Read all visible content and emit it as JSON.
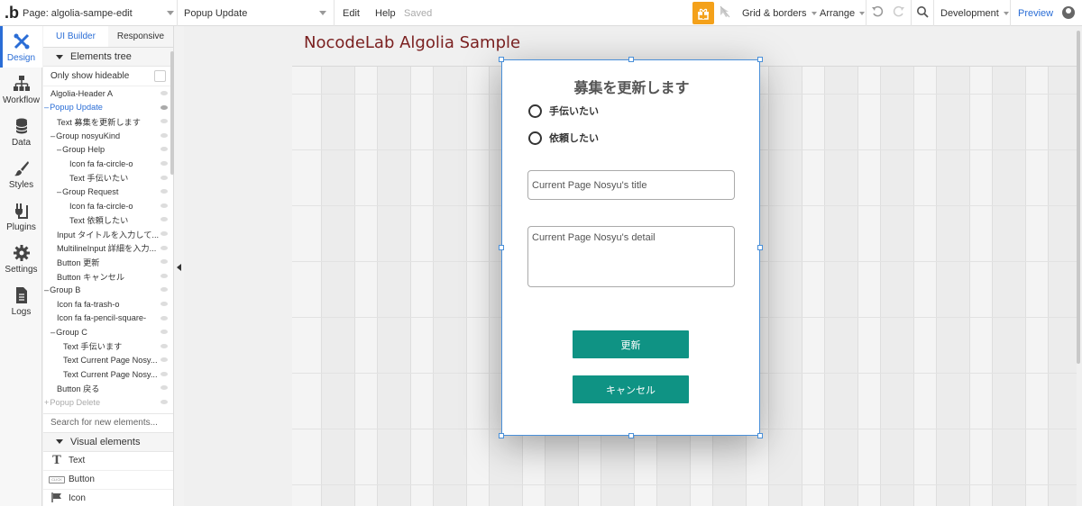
{
  "topbar": {
    "logo": ".b",
    "page_select": "Page: algolia-sampe-edit",
    "element_select": "Popup Update",
    "edit": "Edit",
    "help": "Help",
    "saved": "Saved",
    "grid_borders": "Grid & borders",
    "arrange": "Arrange",
    "environment": "Development",
    "preview": "Preview"
  },
  "rail": {
    "items": [
      {
        "label": "Design",
        "icon": "design-icon"
      },
      {
        "label": "Workflow",
        "icon": "workflow-icon"
      },
      {
        "label": "Data",
        "icon": "data-icon"
      },
      {
        "label": "Styles",
        "icon": "styles-icon"
      },
      {
        "label": "Plugins",
        "icon": "plugins-icon"
      },
      {
        "label": "Settings",
        "icon": "settings-icon"
      },
      {
        "label": "Logs",
        "icon": "logs-icon"
      }
    ]
  },
  "panel": {
    "tabs": [
      "UI Builder",
      "Responsive"
    ],
    "elements_tree_header": "Elements tree",
    "only_show_hideable": "Only show hideable",
    "tree": [
      {
        "label": "Algolia-Header A",
        "level": 0,
        "prefix": ""
      },
      {
        "label": "Popup Update",
        "level": 0,
        "prefix": "–",
        "selected": true
      },
      {
        "label": "Text 募集を更新します",
        "level": 1,
        "prefix": ""
      },
      {
        "label": "Group nosyuKind",
        "level": 1,
        "prefix": "–"
      },
      {
        "label": "Group Help",
        "level": 2,
        "prefix": "–"
      },
      {
        "label": "Icon fa fa-circle-o",
        "level": 3,
        "prefix": ""
      },
      {
        "label": "Text 手伝いたい",
        "level": 3,
        "prefix": ""
      },
      {
        "label": "Group Request",
        "level": 2,
        "prefix": "–"
      },
      {
        "label": "Icon fa fa-circle-o",
        "level": 3,
        "prefix": ""
      },
      {
        "label": "Text 依頼したい",
        "level": 3,
        "prefix": ""
      },
      {
        "label": "Input タイトルを入力して...",
        "level": 1,
        "prefix": ""
      },
      {
        "label": "MultilineInput 詳細を入力...",
        "level": 1,
        "prefix": ""
      },
      {
        "label": "Button 更新",
        "level": 1,
        "prefix": ""
      },
      {
        "label": "Button キャンセル",
        "level": 1,
        "prefix": ""
      },
      {
        "label": "Group B",
        "level": 0,
        "prefix": "–"
      },
      {
        "label": "Icon fa fa-trash-o",
        "level": 1,
        "prefix": ""
      },
      {
        "label": "Icon fa fa-pencil-square-",
        "level": 1,
        "prefix": ""
      },
      {
        "label": "Group C",
        "level": 1,
        "prefix": "–"
      },
      {
        "label": "Text 手伝います",
        "level": 2,
        "prefix": ""
      },
      {
        "label": "Text Current Page Nosy...",
        "level": 2,
        "prefix": ""
      },
      {
        "label": "Text Current Page Nosy...",
        "level": 2,
        "prefix": ""
      },
      {
        "label": "Button 戻る",
        "level": 1,
        "prefix": ""
      },
      {
        "label": "Popup Delete",
        "level": 0,
        "prefix": "+",
        "dim": true
      }
    ],
    "search_placeholder": "Search for new elements...",
    "visual_elements_header": "Visual elements",
    "visual_elements": [
      {
        "label": "Text",
        "icon": "text-icon"
      },
      {
        "label": "Button",
        "icon": "button-icon"
      },
      {
        "label": "Icon",
        "icon": "flag-icon"
      }
    ]
  },
  "canvas": {
    "page_title": "NocodeLab Algolia Sample",
    "popup": {
      "title": "募集を更新します",
      "radio_help": "手伝いたい",
      "radio_request": "依頼したい",
      "title_input": "Current Page Nosyu's title",
      "detail_input": "Current Page Nosyu's detail",
      "update_button": "更新",
      "cancel_button": "キャンセル"
    }
  },
  "colors": {
    "accent": "#2a6dd6",
    "button": "#0f9384",
    "page_title": "#7a1f1f",
    "gift": "#f4a11a"
  }
}
